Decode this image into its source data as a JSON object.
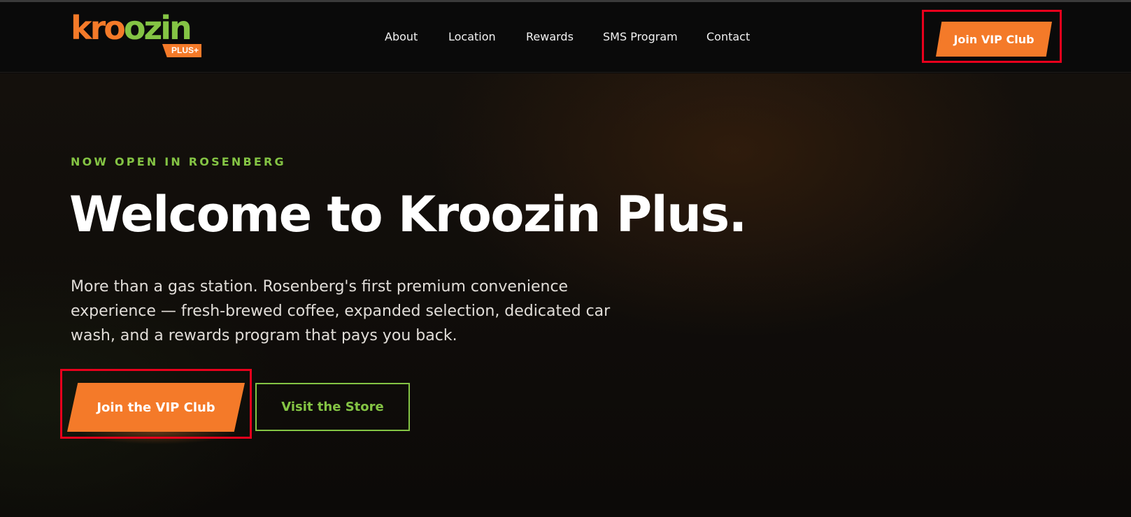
{
  "brand": {
    "logo_main": "kroozin",
    "logo_badge": "PLUS+",
    "primary_color": "#f47a29",
    "accent_color": "#84c444"
  },
  "nav": {
    "links": [
      "About",
      "Location",
      "Rewards",
      "SMS Program",
      "Contact"
    ],
    "cta_label": "Join VIP Club"
  },
  "hero": {
    "eyebrow": "NOW OPEN IN ROSENBERG",
    "headline": "Welcome to Kroozin Plus.",
    "description": "More than a gas station. Rosenberg's first premium convenience experience — fresh-brewed coffee, expanded selection, dedicated car wash, and a rewards program that pays you back.",
    "primary_button": "Join the VIP Club",
    "secondary_button": "Visit the Store"
  }
}
